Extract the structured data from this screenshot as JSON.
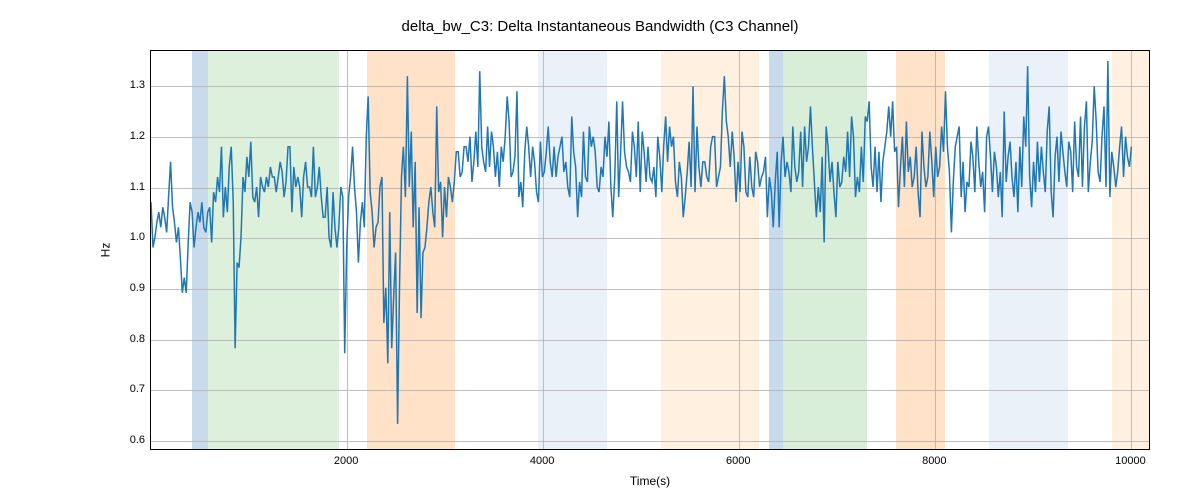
{
  "chart_data": {
    "type": "line",
    "title": "delta_bw_C3: Delta Instantaneous Bandwidth (C3 Channel)",
    "xlabel": "Time(s)",
    "ylabel": "Hz",
    "xlim": [
      0,
      10200
    ],
    "ylim": [
      0.58,
      1.37
    ],
    "xticks": [
      2000,
      4000,
      6000,
      8000,
      10000
    ],
    "yticks": [
      0.6,
      0.7,
      0.8,
      0.9,
      1.0,
      1.1,
      1.2,
      1.3
    ],
    "bands": [
      {
        "x0": 420,
        "x1": 580,
        "color": "#9abedf",
        "alpha": 0.55
      },
      {
        "x0": 580,
        "x1": 1920,
        "color": "#bfe3bf",
        "alpha": 0.55
      },
      {
        "x0": 2200,
        "x1": 3100,
        "color": "#ffcfa1",
        "alpha": 0.6
      },
      {
        "x0": 3950,
        "x1": 4650,
        "color": "#d5e3f3",
        "alpha": 0.5
      },
      {
        "x0": 5200,
        "x1": 6200,
        "color": "#ffe6cc",
        "alpha": 0.6
      },
      {
        "x0": 6300,
        "x1": 6450,
        "color": "#9abedf",
        "alpha": 0.55
      },
      {
        "x0": 6450,
        "x1": 7300,
        "color": "#bfe3bf",
        "alpha": 0.6
      },
      {
        "x0": 7600,
        "x1": 8100,
        "color": "#ffcfa1",
        "alpha": 0.6
      },
      {
        "x0": 8550,
        "x1": 9350,
        "color": "#d5e3f3",
        "alpha": 0.5
      },
      {
        "x0": 9800,
        "x1": 10200,
        "color": "#ffe6cc",
        "alpha": 0.6
      }
    ],
    "x": [
      0,
      20,
      40,
      60,
      80,
      100,
      120,
      140,
      160,
      180,
      200,
      220,
      240,
      260,
      280,
      300,
      320,
      340,
      360,
      380,
      400,
      420,
      440,
      460,
      480,
      500,
      520,
      540,
      560,
      580,
      600,
      620,
      640,
      660,
      680,
      700,
      720,
      740,
      760,
      780,
      800,
      820,
      840,
      860,
      880,
      900,
      920,
      940,
      960,
      980,
      1000,
      1020,
      1040,
      1060,
      1080,
      1100,
      1120,
      1140,
      1160,
      1180,
      1200,
      1220,
      1240,
      1260,
      1280,
      1300,
      1320,
      1340,
      1360,
      1380,
      1400,
      1420,
      1440,
      1460,
      1480,
      1500,
      1520,
      1540,
      1560,
      1580,
      1600,
      1620,
      1640,
      1660,
      1680,
      1700,
      1720,
      1740,
      1760,
      1780,
      1800,
      1820,
      1840,
      1860,
      1880,
      1900,
      1920,
      1940,
      1960,
      1980,
      2000,
      2020,
      2040,
      2060,
      2080,
      2100,
      2120,
      2140,
      2160,
      2180,
      2200,
      2220,
      2240,
      2260,
      2280,
      2300,
      2320,
      2340,
      2360,
      2380,
      2400,
      2420,
      2440,
      2460,
      2480,
      2500,
      2520,
      2540,
      2560,
      2580,
      2600,
      2620,
      2640,
      2660,
      2680,
      2700,
      2720,
      2740,
      2760,
      2780,
      2800,
      2820,
      2840,
      2860,
      2880,
      2900,
      2920,
      2940,
      2960,
      2980,
      3000,
      3020,
      3040,
      3060,
      3080,
      3100,
      3120,
      3140,
      3160,
      3180,
      3200,
      3220,
      3240,
      3260,
      3280,
      3300,
      3320,
      3340,
      3360,
      3380,
      3400,
      3420,
      3440,
      3460,
      3480,
      3500,
      3520,
      3540,
      3560,
      3580,
      3600,
      3620,
      3640,
      3660,
      3680,
      3700,
      3720,
      3740,
      3760,
      3780,
      3800,
      3820,
      3840,
      3860,
      3880,
      3900,
      3920,
      3940,
      3960,
      3980,
      4000,
      4020,
      4040,
      4060,
      4080,
      4100,
      4120,
      4140,
      4160,
      4180,
      4200,
      4220,
      4240,
      4260,
      4280,
      4300,
      4320,
      4340,
      4360,
      4380,
      4400,
      4420,
      4440,
      4460,
      4480,
      4500,
      4520,
      4540,
      4560,
      4580,
      4600,
      4620,
      4640,
      4660,
      4680,
      4700,
      4720,
      4740,
      4760,
      4780,
      4800,
      4820,
      4840,
      4860,
      4880,
      4900,
      4920,
      4940,
      4960,
      4980,
      5000,
      5020,
      5040,
      5060,
      5080,
      5100,
      5120,
      5140,
      5160,
      5180,
      5200,
      5220,
      5240,
      5260,
      5280,
      5300,
      5320,
      5340,
      5360,
      5380,
      5400,
      5420,
      5440,
      5460,
      5480,
      5500,
      5520,
      5540,
      5560,
      5580,
      5600,
      5620,
      5640,
      5660,
      5680,
      5700,
      5720,
      5740,
      5760,
      5780,
      5800,
      5820,
      5840,
      5860,
      5880,
      5900,
      5920,
      5940,
      5960,
      5980,
      6000,
      6020,
      6040,
      6060,
      6080,
      6100,
      6120,
      6140,
      6160,
      6180,
      6200,
      6220,
      6240,
      6260,
      6280,
      6300,
      6320,
      6340,
      6360,
      6380,
      6400,
      6420,
      6440,
      6460,
      6480,
      6500,
      6520,
      6540,
      6560,
      6580,
      6600,
      6620,
      6640,
      6660,
      6680,
      6700,
      6720,
      6740,
      6760,
      6780,
      6800,
      6820,
      6840,
      6860,
      6880,
      6900,
      6920,
      6940,
      6960,
      6980,
      7000,
      7020,
      7040,
      7060,
      7080,
      7100,
      7120,
      7140,
      7160,
      7180,
      7200,
      7220,
      7240,
      7260,
      7280,
      7300,
      7320,
      7340,
      7360,
      7380,
      7400,
      7420,
      7440,
      7460,
      7480,
      7500,
      7520,
      7540,
      7560,
      7580,
      7600,
      7620,
      7640,
      7660,
      7680,
      7700,
      7720,
      7740,
      7760,
      7780,
      7800,
      7820,
      7840,
      7860,
      7880,
      7900,
      7920,
      7940,
      7960,
      7980,
      8000,
      8020,
      8040,
      8060,
      8080,
      8100,
      8120,
      8140,
      8160,
      8180,
      8200,
      8220,
      8240,
      8260,
      8280,
      8300,
      8320,
      8340,
      8360,
      8380,
      8400,
      8420,
      8440,
      8460,
      8480,
      8500,
      8520,
      8540,
      8560,
      8580,
      8600,
      8620,
      8640,
      8660,
      8680,
      8700,
      8720,
      8740,
      8760,
      8780,
      8800,
      8820,
      8840,
      8860,
      8880,
      8900,
      8920,
      8940,
      8960,
      8980,
      9000,
      9020,
      9040,
      9060,
      9080,
      9100,
      9120,
      9140,
      9160,
      9180,
      9200,
      9220,
      9240,
      9260,
      9280,
      9300,
      9320,
      9340,
      9360,
      9380,
      9400,
      9420,
      9440,
      9460,
      9480,
      9500,
      9520,
      9540,
      9560,
      9580,
      9600,
      9620,
      9640,
      9660,
      9680,
      9700,
      9720,
      9740,
      9760,
      9780,
      9800,
      9820,
      9840,
      9860,
      9880,
      9900,
      9920,
      9940,
      9960,
      9980,
      10000,
      10020,
      10040,
      10060,
      10080,
      10100,
      10120,
      10140,
      10160,
      10180,
      10200
    ],
    "y": [
      1.07,
      0.98,
      1.0,
      1.03,
      1.05,
      1.02,
      1.06,
      1.04,
      1.01,
      1.08,
      1.15,
      1.06,
      1.03,
      0.99,
      1.02,
      0.96,
      0.89,
      0.92,
      0.89,
      0.99,
      1.07,
      1.05,
      0.98,
      1.02,
      1.05,
      1.03,
      1.07,
      1.02,
      1.01,
      1.05,
      1.06,
      0.99,
      1.09,
      1.07,
      1.12,
      1.09,
      1.18,
      1.04,
      1.1,
      1.05,
      1.14,
      1.18,
      1.07,
      0.78,
      0.95,
      0.94,
      1.0,
      1.12,
      1.09,
      1.16,
      1.12,
      1.19,
      1.08,
      1.07,
      1.1,
      1.04,
      1.12,
      1.1,
      1.09,
      1.12,
      1.1,
      1.14,
      1.12,
      1.12,
      1.09,
      1.12,
      1.15,
      1.13,
      1.08,
      1.11,
      1.18,
      1.18,
      1.05,
      1.14,
      1.1,
      1.12,
      1.1,
      1.04,
      1.12,
      1.15,
      1.1,
      1.1,
      1.08,
      1.18,
      1.08,
      1.1,
      1.14,
      1.08,
      1.04,
      1.04,
      1.1,
      1.0,
      0.98,
      1.09,
      1.02,
      0.98,
      1.02,
      1.1,
      1.08,
      0.77,
      0.98,
      1.08,
      1.12,
      1.18,
      1.1,
      1.05,
      0.95,
      1.03,
      1.07,
      1.02,
      1.2,
      1.28,
      1.09,
      1.05,
      0.98,
      1.02,
      1.03,
      1.1,
      1.12,
      0.83,
      0.9,
      0.75,
      1.05,
      0.78,
      0.88,
      0.97,
      0.63,
      0.9,
      1.12,
      1.18,
      1.08,
      1.32,
      1.1,
      1.21,
      1.02,
      1.15,
      0.85,
      1.06,
      0.84,
      0.97,
      0.98,
      1.02,
      1.07,
      1.1,
      1.05,
      1.02,
      1.26,
      1.09,
      1.11,
      1.0,
      1.1,
      1.04,
      1.12,
      1.1,
      1.07,
      1.11,
      1.17,
      1.17,
      1.12,
      1.13,
      1.18,
      1.18,
      1.15,
      1.2,
      1.11,
      1.15,
      1.21,
      1.14,
      1.33,
      1.18,
      1.15,
      1.13,
      1.22,
      1.14,
      1.21,
      1.18,
      1.12,
      1.17,
      1.1,
      1.18,
      1.15,
      1.2,
      1.28,
      1.23,
      1.12,
      1.13,
      1.16,
      1.29,
      1.08,
      1.11,
      1.06,
      1.17,
      1.22,
      1.18,
      1.12,
      1.18,
      1.15,
      1.09,
      1.07,
      1.19,
      1.12,
      1.13,
      1.17,
      1.22,
      1.15,
      1.12,
      1.18,
      1.12,
      1.16,
      1.18,
      1.2,
      1.13,
      1.15,
      1.1,
      1.08,
      1.24,
      1.17,
      1.14,
      1.04,
      1.11,
      1.08,
      1.21,
      1.12,
      1.11,
      1.22,
      1.18,
      1.2,
      1.17,
      1.1,
      1.09,
      1.14,
      1.12,
      1.2,
      1.16,
      1.23,
      1.1,
      1.04,
      1.12,
      1.27,
      1.08,
      1.17,
      1.27,
      1.17,
      1.14,
      1.13,
      1.11,
      1.21,
      1.18,
      1.12,
      1.23,
      1.09,
      1.21,
      1.17,
      1.11,
      1.18,
      1.12,
      1.11,
      1.14,
      1.08,
      1.2,
      1.16,
      1.09,
      1.18,
      1.24,
      1.15,
      1.22,
      1.18,
      1.2,
      1.11,
      1.08,
      1.15,
      1.12,
      1.04,
      1.08,
      1.13,
      1.19,
      1.1,
      1.3,
      1.09,
      1.22,
      1.14,
      1.1,
      1.15,
      1.15,
      1.12,
      1.11,
      1.18,
      1.2,
      1.2,
      1.1,
      1.12,
      1.14,
      1.25,
      1.32,
      1.23,
      1.2,
      1.14,
      1.21,
      1.16,
      1.07,
      1.15,
      1.09,
      1.21,
      1.18,
      1.09,
      1.08,
      1.16,
      1.1,
      1.08,
      1.17,
      1.15,
      1.1,
      1.12,
      1.13,
      1.16,
      1.04,
      1.12,
      1.09,
      1.02,
      1.11,
      1.17,
      1.02,
      1.15,
      1.2,
      1.12,
      1.15,
      1.13,
      1.09,
      1.22,
      1.14,
      1.11,
      1.13,
      1.21,
      1.1,
      1.22,
      1.15,
      1.18,
      1.26,
      1.18,
      1.11,
      1.04,
      1.1,
      1.05,
      1.16,
      0.99,
      1.22,
      1.18,
      1.11,
      1.15,
      1.09,
      1.04,
      1.15,
      1.1,
      1.11,
      1.16,
      1.13,
      1.21,
      1.12,
      1.24,
      1.2,
      1.08,
      1.12,
      1.09,
      1.18,
      1.11,
      1.24,
      1.23,
      1.27,
      1.14,
      1.1,
      1.18,
      1.09,
      1.17,
      1.07,
      1.15,
      1.18,
      1.21,
      1.26,
      1.2,
      1.27,
      1.17,
      1.18,
      1.06,
      1.14,
      1.2,
      1.1,
      1.23,
      1.13,
      1.16,
      1.1,
      1.12,
      1.18,
      1.09,
      1.04,
      1.21,
      1.14,
      1.1,
      1.12,
      1.21,
      1.15,
      1.08,
      1.18,
      1.12,
      1.14,
      1.22,
      1.17,
      1.29,
      1.18,
      1.13,
      1.01,
      1.11,
      1.18,
      1.2,
      1.22,
      1.08,
      1.15,
      1.05,
      1.11,
      1.1,
      1.19,
      1.16,
      1.09,
      1.22,
      1.15,
      1.1,
      1.13,
      1.05,
      1.2,
      1.22,
      1.16,
      1.09,
      1.17,
      1.14,
      1.08,
      1.13,
      1.04,
      1.25,
      1.11,
      1.16,
      1.19,
      1.12,
      1.08,
      1.15,
      1.05,
      1.18,
      1.1,
      1.24,
      1.18,
      1.34,
      1.12,
      1.06,
      1.15,
      1.09,
      1.19,
      1.11,
      1.18,
      1.13,
      1.09,
      1.21,
      1.26,
      1.09,
      1.04,
      1.16,
      1.2,
      1.11,
      1.21,
      1.17,
      1.13,
      1.1,
      1.19,
      1.17,
      1.09,
      1.23,
      1.14,
      1.12,
      1.24,
      1.1,
      1.22,
      1.27,
      1.09,
      1.15,
      1.19,
      1.3,
      1.23,
      1.13,
      1.11,
      1.2,
      1.26,
      1.1,
      1.35,
      1.08,
      1.17,
      1.14,
      1.1,
      1.13,
      1.18,
      1.22,
      1.12,
      1.2,
      1.16,
      1.14,
      1.18
    ]
  }
}
